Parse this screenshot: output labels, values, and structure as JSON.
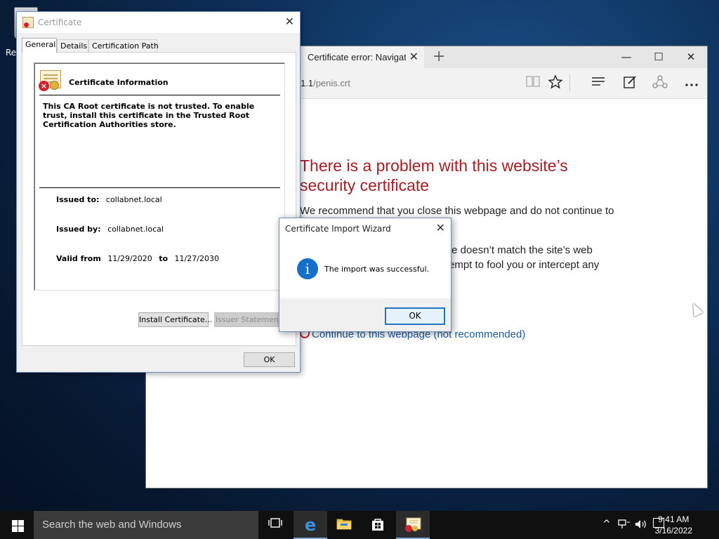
{
  "desktop": {
    "icon_label": "Re"
  },
  "browser": {
    "tab_title": "Certificate error: Navigat",
    "tab_close": "✕",
    "new_tab": "+",
    "minimize": "—",
    "maximize": "☐",
    "close": "✕",
    "url_host": "1.1",
    "url_path": "/penis.crt",
    "error_title": "There is a problem with this website’s security certificate",
    "para1": "We recommend that you close this webpage and do not continue to",
    "para2a": "te doesn’t match the site’s web",
    "para2b": "empt to fool you or intercept any",
    "continue_link": "Continue to this webpage (not recommended)"
  },
  "certificate": {
    "title": "Certificate",
    "close": "✕",
    "tabs": [
      "General",
      "Details",
      "Certification Path"
    ],
    "heading": "Certificate Information",
    "warning": "This CA Root certificate is not trusted. To enable trust, install this certificate in the Trusted Root Certification Authorities store.",
    "issued_to_label": "Issued to:",
    "issued_to": "collabnet.local",
    "issued_by_label": "Issued by:",
    "issued_by": "collabnet.local",
    "valid_from_label": "Valid from",
    "valid_from": "11/29/2020",
    "to_label": "to",
    "valid_to": "11/27/2030",
    "install_button": "Install Certificate...",
    "issuer_button": "Issuer Statement",
    "ok_button": "OK"
  },
  "wizard": {
    "title": "Certificate Import Wizard",
    "close": "✕",
    "info_glyph": "i",
    "message": "The import was successful.",
    "ok_button": "OK"
  },
  "taskbar": {
    "search_placeholder": "Search the web and Windows",
    "time": "9:41 AM",
    "date": "3/16/2022"
  }
}
